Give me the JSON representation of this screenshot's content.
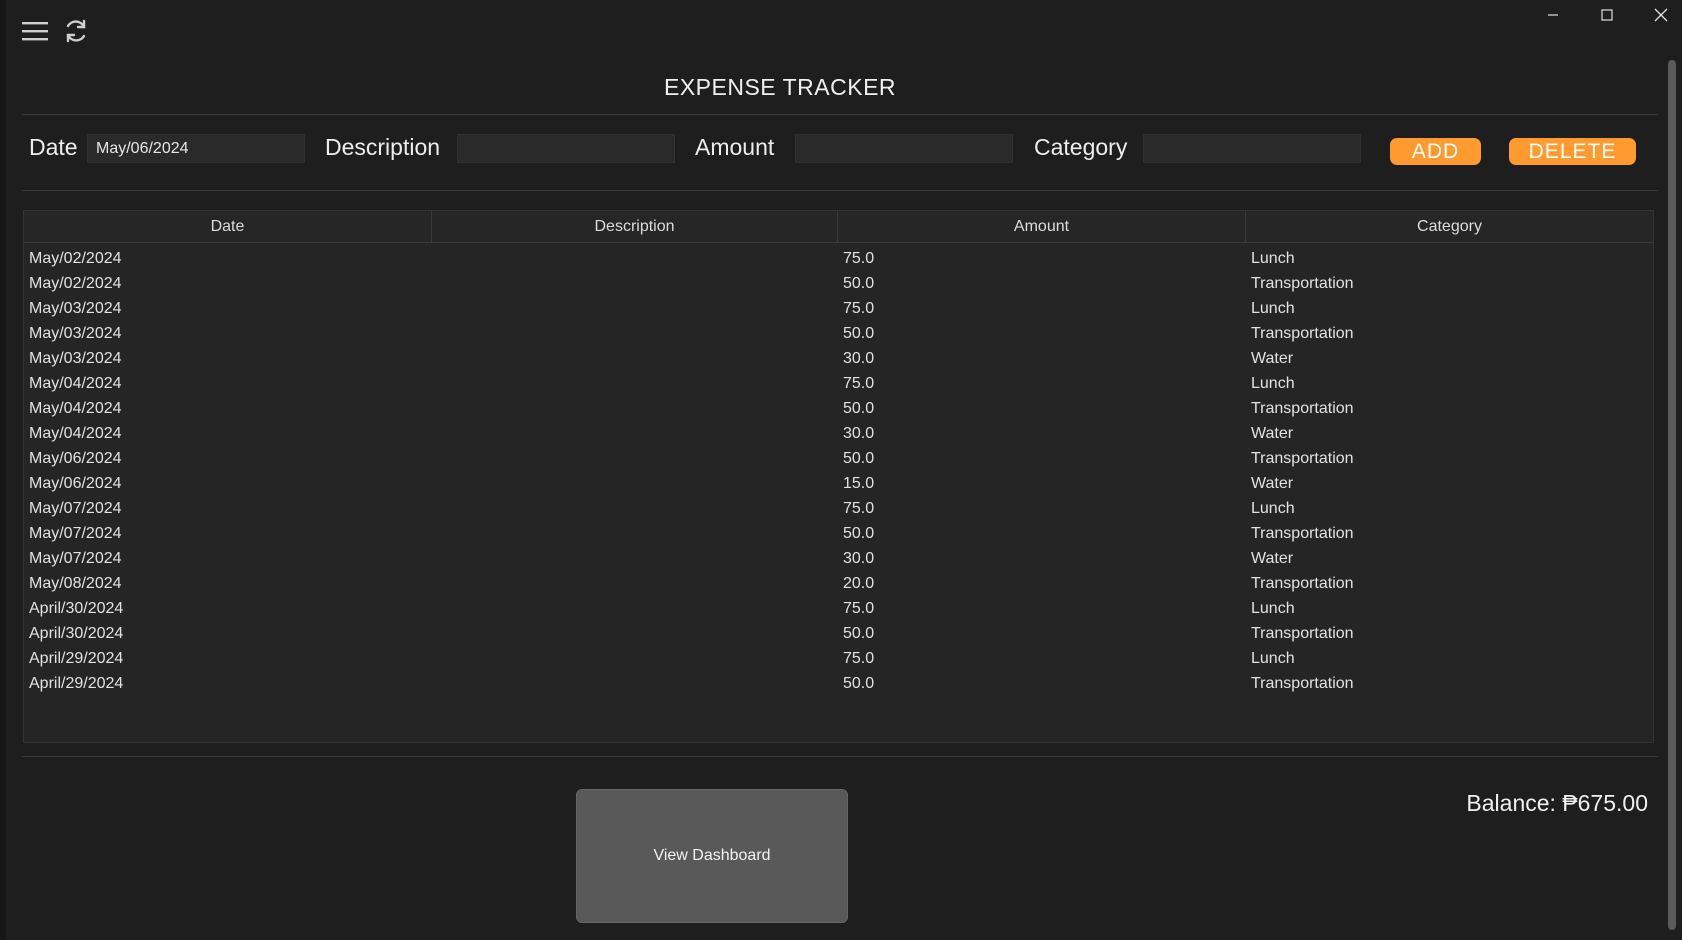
{
  "window": {
    "controls": [
      "minimize-icon",
      "maximize-icon",
      "close-icon"
    ]
  },
  "toolbar": {
    "icons": [
      "hamburger-menu-icon",
      "refresh-icon"
    ]
  },
  "title": "EXPENSE TRACKER",
  "form": {
    "date_label": "Date",
    "date_value": "May/06/2024",
    "description_label": "Description",
    "description_value": "",
    "amount_label": "Amount",
    "amount_value": "",
    "category_label": "Category",
    "category_value": "",
    "add_label": "ADD",
    "delete_label": "DELETE"
  },
  "table": {
    "columns": [
      "Date",
      "Description",
      "Amount",
      "Category"
    ],
    "rows": [
      [
        "May/02/2024",
        "",
        "75.0",
        "Lunch"
      ],
      [
        "May/02/2024",
        "",
        "50.0",
        "Transportation"
      ],
      [
        "May/03/2024",
        "",
        "75.0",
        "Lunch"
      ],
      [
        "May/03/2024",
        "",
        "50.0",
        "Transportation"
      ],
      [
        "May/03/2024",
        "",
        "30.0",
        "Water"
      ],
      [
        "May/04/2024",
        "",
        "75.0",
        "Lunch"
      ],
      [
        "May/04/2024",
        "",
        "50.0",
        "Transportation"
      ],
      [
        "May/04/2024",
        "",
        "30.0",
        "Water"
      ],
      [
        "May/06/2024",
        "",
        "50.0",
        "Transportation"
      ],
      [
        "May/06/2024",
        "",
        "15.0",
        "Water"
      ],
      [
        "May/07/2024",
        "",
        "75.0",
        "Lunch"
      ],
      [
        "May/07/2024",
        "",
        "50.0",
        "Transportation"
      ],
      [
        "May/07/2024",
        "",
        "30.0",
        "Water"
      ],
      [
        "May/08/2024",
        "",
        "20.0",
        "Transportation"
      ],
      [
        "April/30/2024",
        "",
        "75.0",
        "Lunch"
      ],
      [
        "April/30/2024",
        "",
        "50.0",
        "Transportation"
      ],
      [
        "April/29/2024",
        "",
        "75.0",
        "Lunch"
      ],
      [
        "April/29/2024",
        "",
        "50.0",
        "Transportation"
      ]
    ]
  },
  "dashboard_button": "View Dashboard",
  "balance": "Balance: ₱675.00",
  "colors": {
    "background": "#1e1e1e",
    "accent": "#ff9a2e",
    "button_gray": "#595959"
  }
}
